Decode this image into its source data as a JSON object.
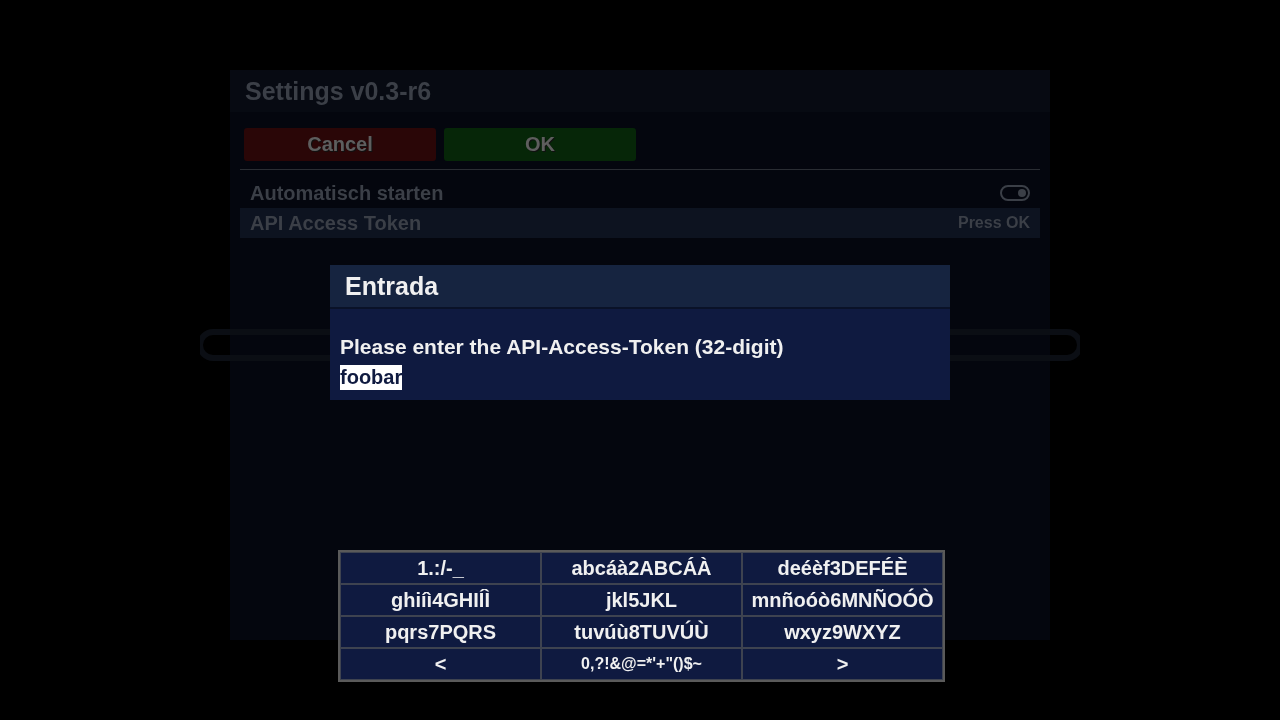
{
  "window": {
    "title": "Settings v0.3-r6"
  },
  "buttons": [
    {
      "label": "Cancel",
      "kind": "cancel"
    },
    {
      "label": "OK",
      "kind": "ok"
    }
  ],
  "settings": [
    {
      "label": "Automatisch starten",
      "kind": "toggle",
      "on": true,
      "selected": false
    },
    {
      "label": "API Access Token",
      "kind": "action",
      "value": "Press OK",
      "selected": true
    }
  ],
  "dialog": {
    "title": "Entrada",
    "prompt": "Please enter the API-Access-Token (32-digit)",
    "value": "foobar"
  },
  "keyboard": [
    [
      "1.:/-_",
      "abcáà2ABCÁÀ",
      "deéèf3DEFÉÈ"
    ],
    [
      "ghiíì4GHIÍÌ",
      "jkl5JKL",
      "mnñoóò6MNÑOÓÒ"
    ],
    [
      "pqrs7PQRS",
      "tuvúù8TUVÚÙ",
      "wxyz9WXYZ"
    ],
    [
      "<",
      "0,?!&@=*'+\"()$~",
      ">"
    ]
  ]
}
